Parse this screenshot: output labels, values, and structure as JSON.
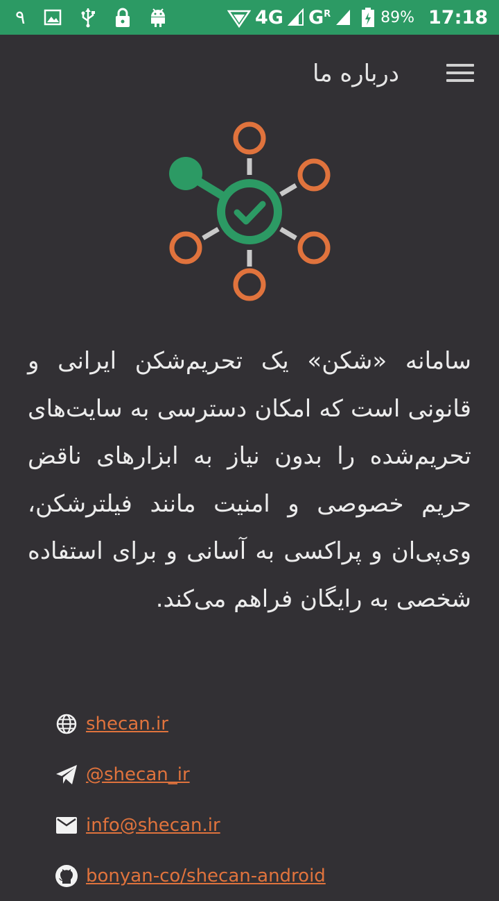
{
  "status_bar": {
    "left_digit": "۹",
    "network_1": "4G",
    "network_2": "G",
    "network_2_sup": "R",
    "battery_percent": "89%",
    "time": "17:18",
    "icons": [
      "image-icon",
      "usb-icon",
      "lock-icon",
      "android-icon",
      "hotspot-icon",
      "signal-icon",
      "battery-icon"
    ]
  },
  "header": {
    "title": "درباره ما",
    "menu_icon": "hamburger-menu-icon"
  },
  "logo": {
    "hub_color": "#2c9a64",
    "node_color": "#e0733d",
    "connector_color": "#c9c9c9"
  },
  "about": {
    "text": "سامانه «شکن» یک تحریم‌شکن ایرانی و قانونی است که امکان دسترسی به سایت‌های تحریم‌شده را بدون نیاز به ابزارهای ناقض حریم خصوصی و امنیت مانند فیلترشکن، وی‌پی‌ان و پراکسی به آسانی و برای استفاده شخصی به رایگان فراهم می‌کند."
  },
  "links": [
    {
      "icon": "globe-icon",
      "text": "shecan.ir"
    },
    {
      "icon": "telegram-icon",
      "text": "@shecan_ir"
    },
    {
      "icon": "email-icon",
      "text": "info@shecan.ir"
    },
    {
      "icon": "github-icon",
      "text": "bonyan-co/shecan-android"
    }
  ],
  "colors": {
    "status_bar": "#2c9a64",
    "background": "#323034",
    "link": "#e0733d",
    "text": "#ececec"
  }
}
